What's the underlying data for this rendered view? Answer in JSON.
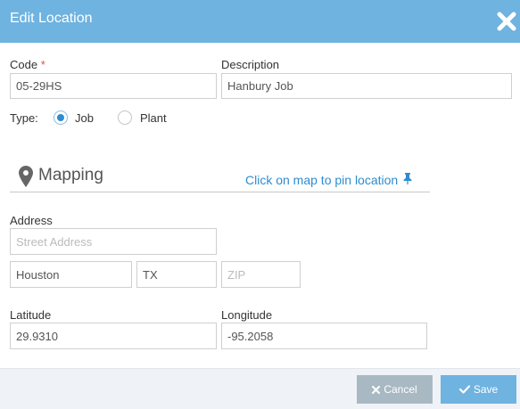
{
  "dialog": {
    "title": "Edit Location"
  },
  "form": {
    "code_label": "Code",
    "code_required": "*",
    "code_value": "05-29HS",
    "description_label": "Description",
    "description_value": "Hanbury Job",
    "type_label": "Type:",
    "type_options": [
      {
        "label": "Job",
        "selected": true
      },
      {
        "label": "Plant",
        "selected": false
      }
    ]
  },
  "mapping": {
    "title": "Mapping",
    "pin_link": "Click on map to pin location"
  },
  "address": {
    "label": "Address",
    "street_placeholder": "Street Address",
    "street_value": "",
    "city_value": "Houston",
    "state_value": "TX",
    "zip_placeholder": "ZIP",
    "zip_value": ""
  },
  "coords": {
    "latitude_label": "Latitude",
    "latitude_value": "29.9310",
    "longitude_label": "Longitude",
    "longitude_value": "-95.2058"
  },
  "footer": {
    "cancel_label": "Cancel",
    "save_label": "Save"
  },
  "colors": {
    "header": "#6fb3e0",
    "accent": "#2d8ccf",
    "cancel": "#a9b9c3"
  }
}
